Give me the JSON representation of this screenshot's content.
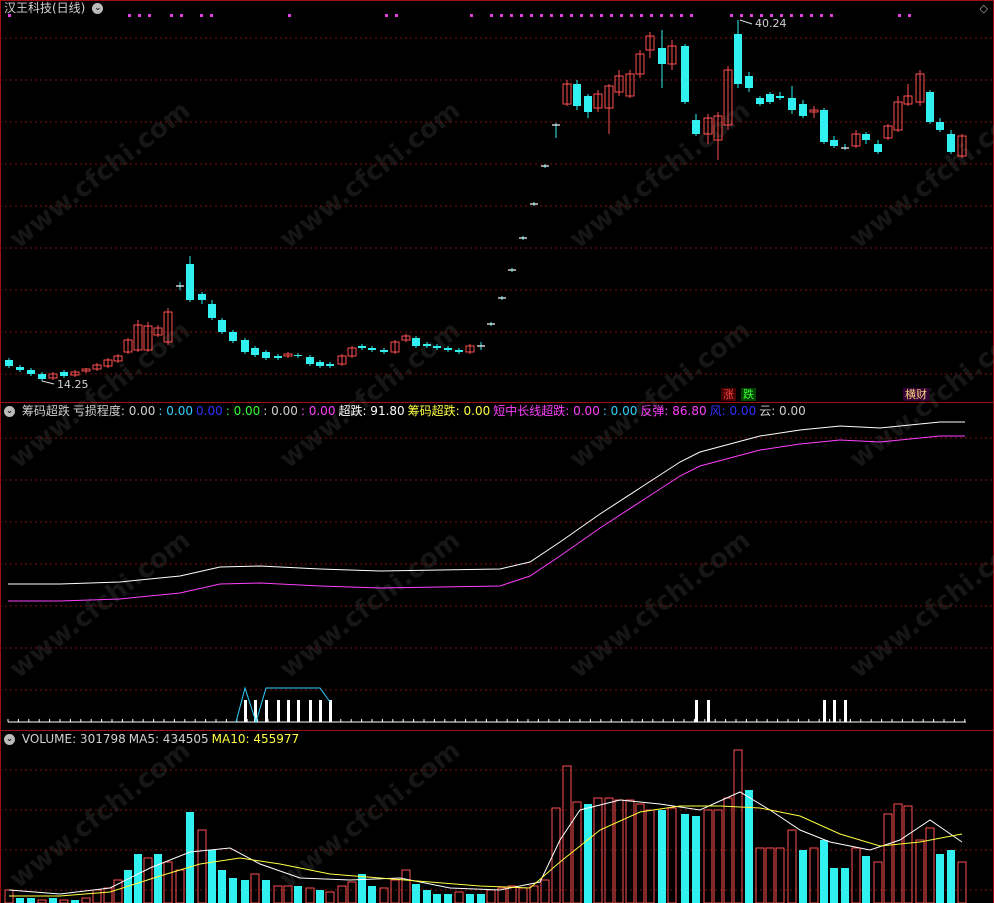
{
  "top": {
    "title": "汉王科技(日线)",
    "high_label": "40.24",
    "low_label": "14.25",
    "tags": [
      {
        "text": "涨",
        "color": "#ff4040"
      },
      {
        "text": "跌",
        "color": "#40ff40"
      },
      {
        "text": "横财",
        "color": "#e0a0ff"
      }
    ]
  },
  "indicator": {
    "items": [
      {
        "text": "筹码超跌",
        "color": "#d0d0d0"
      },
      {
        "text": "亏损程度: 0.00",
        "color": "#d0d0d0"
      },
      {
        "text": ": 0.00",
        "color": "#30d0ff"
      },
      {
        "text": "0.00",
        "color": "#3030ff"
      },
      {
        "text": ": 0.00",
        "color": "#30ff30"
      },
      {
        "text": ": 0.00",
        "color": "#d0d0d0"
      },
      {
        "text": ": 0.00",
        "color": "#ff40ff"
      },
      {
        "text": "超跌: 91.80",
        "color": "#ffffff"
      },
      {
        "text": "筹码超跌: 0.00",
        "color": "#ffff40"
      },
      {
        "text": "短中长线超跌: 0.00",
        "color": "#ff40ff"
      },
      {
        "text": ": 0.00",
        "color": "#30d0ff"
      },
      {
        "text": "反弹: 86.80",
        "color": "#ff40ff"
      },
      {
        "text": "风: 0.00",
        "color": "#3030ff"
      },
      {
        "text": "云: 0.00",
        "color": "#d0d0d0"
      }
    ]
  },
  "volume": {
    "items": [
      {
        "text": "VOLUME: 301798",
        "color": "#d0d0d0"
      },
      {
        "text": "MA5: 434505",
        "color": "#d0d0d0"
      },
      {
        "text": "MA10: 455977",
        "color": "#ffff40"
      }
    ]
  },
  "watermark": "www.cfchi.com",
  "colors": {
    "up": "#ff5050",
    "down": "#30f0f0",
    "grid": "#a01010",
    "white": "#ffffff",
    "magenta": "#ff40ff",
    "yellow": "#ffff40"
  }
}
